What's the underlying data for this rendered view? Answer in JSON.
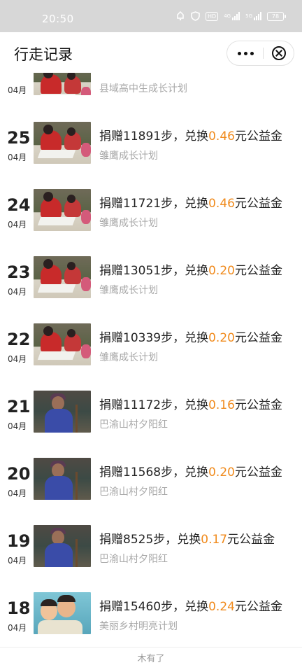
{
  "status_bar": {
    "time": "20:50",
    "icons": [
      "alarm-icon",
      "shield-icon",
      "hd-icon",
      "signal-4g-icon",
      "signal-5g-icon"
    ],
    "hd_label": "HD",
    "net1_label": "4G",
    "net2_label": "5G",
    "battery": "78"
  },
  "header": {
    "title": "行走记录"
  },
  "records_partial": {
    "month": "04月",
    "project": "县域高中生成长计划"
  },
  "records": [
    {
      "day": "25",
      "month": "04月",
      "prefix": "捐赠11891步，兑换",
      "amount": "0.46",
      "suffix": "元公益金",
      "project": "雏鹰成长计划",
      "thumb": "study"
    },
    {
      "day": "24",
      "month": "04月",
      "prefix": "捐赠11721步，兑换",
      "amount": "0.46",
      "suffix": "元公益金",
      "project": "雏鹰成长计划",
      "thumb": "study"
    },
    {
      "day": "23",
      "month": "04月",
      "prefix": "捐赠13051步，兑换",
      "amount": "0.20",
      "suffix": "元公益金",
      "project": "雏鹰成长计划",
      "thumb": "study"
    },
    {
      "day": "22",
      "month": "04月",
      "prefix": "捐赠10339步，兑换",
      "amount": "0.20",
      "suffix": "元公益金",
      "project": "雏鹰成长计划",
      "thumb": "study"
    },
    {
      "day": "21",
      "month": "04月",
      "prefix": "捐赠11172步，兑换",
      "amount": "0.16",
      "suffix": "元公益金",
      "project": "巴渝山村夕阳红",
      "thumb": "elder"
    },
    {
      "day": "20",
      "month": "04月",
      "prefix": "捐赠11568步，兑换",
      "amount": "0.20",
      "suffix": "元公益金",
      "project": "巴渝山村夕阳红",
      "thumb": "elder"
    },
    {
      "day": "19",
      "month": "04月",
      "prefix": "捐赠8525步，兑换",
      "amount": "0.17",
      "suffix": "元公益金",
      "project": "巴渝山村夕阳红",
      "thumb": "elder"
    },
    {
      "day": "18",
      "month": "04月",
      "prefix": "捐赠15460步，兑换",
      "amount": "0.24",
      "suffix": "元公益金",
      "project": "美丽乡村明亮计划",
      "thumb": "kids"
    }
  ],
  "footer": {
    "text": "木有了"
  },
  "colors": {
    "amount": "#f08a1c",
    "project_text": "#a8a8a8",
    "status_bar_bg": "#d7d7d7"
  }
}
